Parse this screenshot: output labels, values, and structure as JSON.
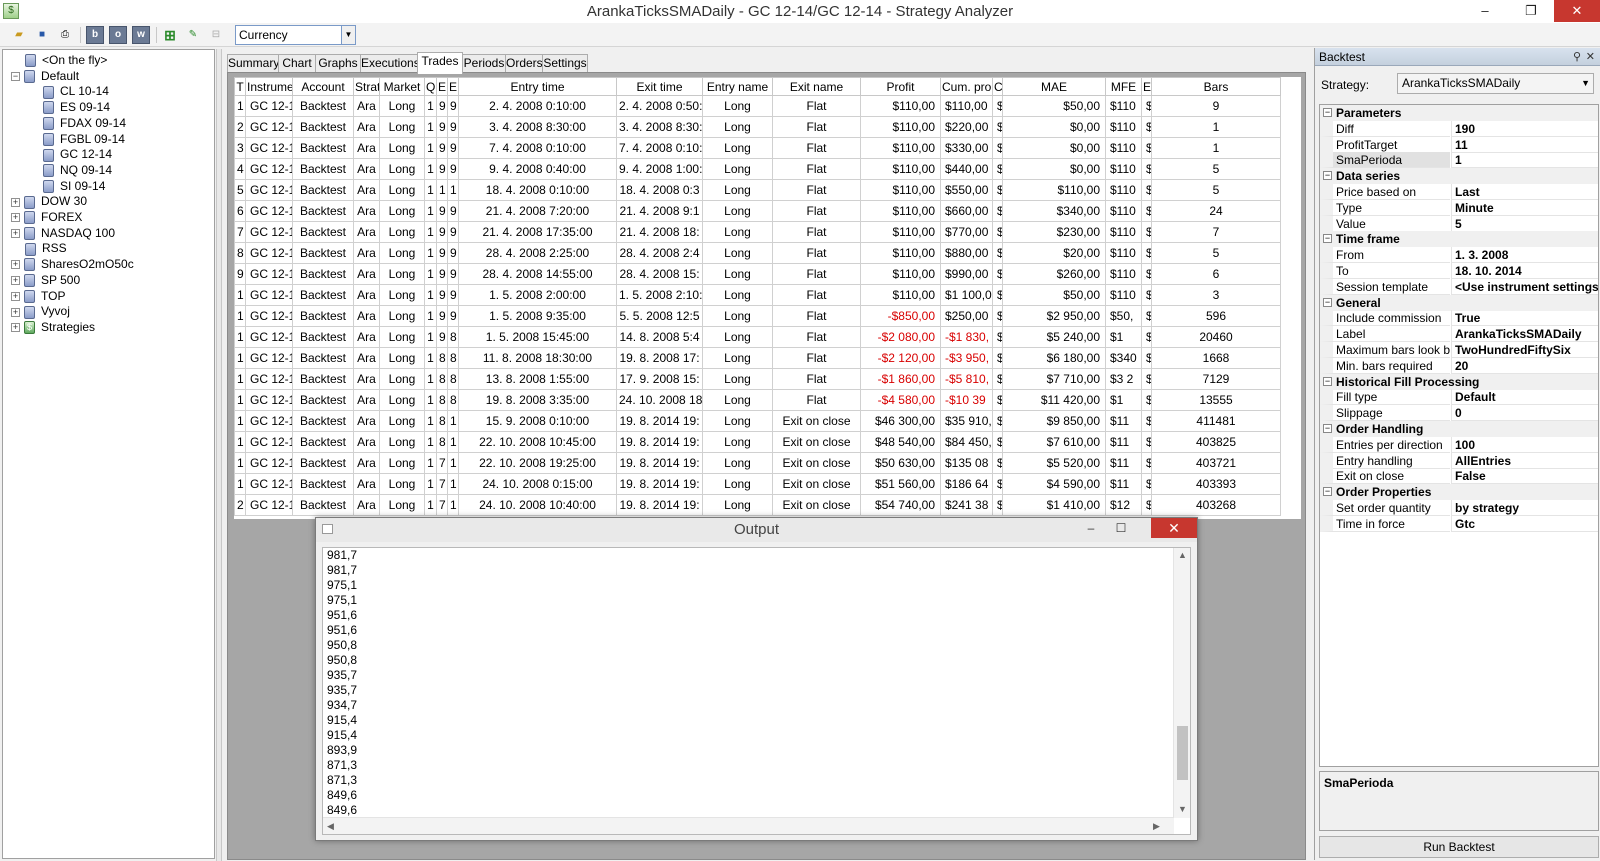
{
  "window": {
    "title": "ArankaTicksSMADaily - GC 12-14/GC 12-14 - Strategy Analyzer",
    "minimize": "–",
    "maximize": "❐",
    "close": "✕"
  },
  "toolbar": {
    "btn_b": "b",
    "btn_o": "o",
    "btn_w": "w",
    "currency": "Currency"
  },
  "tree": [
    {
      "label": "<On the fly>",
      "indent": 1,
      "expander": "",
      "icon": "db"
    },
    {
      "label": "Default",
      "indent": 0,
      "expander": "−",
      "icon": "db"
    },
    {
      "label": "CL 10-14",
      "indent": 2,
      "expander": "",
      "icon": "db"
    },
    {
      "label": "ES 09-14",
      "indent": 2,
      "expander": "",
      "icon": "db"
    },
    {
      "label": "FDAX 09-14",
      "indent": 2,
      "expander": "",
      "icon": "db"
    },
    {
      "label": "FGBL 09-14",
      "indent": 2,
      "expander": "",
      "icon": "db"
    },
    {
      "label": "GC 12-14",
      "indent": 2,
      "expander": "",
      "icon": "db"
    },
    {
      "label": "NQ 09-14",
      "indent": 2,
      "expander": "",
      "icon": "db"
    },
    {
      "label": "SI 09-14",
      "indent": 2,
      "expander": "",
      "icon": "db"
    },
    {
      "label": "DOW 30",
      "indent": 0,
      "expander": "+",
      "icon": "db"
    },
    {
      "label": "FOREX",
      "indent": 0,
      "expander": "+",
      "icon": "db"
    },
    {
      "label": "NASDAQ 100",
      "indent": 0,
      "expander": "+",
      "icon": "db"
    },
    {
      "label": "RSS",
      "indent": 1,
      "expander": "",
      "icon": "db"
    },
    {
      "label": "SharesO2mO50c",
      "indent": 0,
      "expander": "+",
      "icon": "db"
    },
    {
      "label": "SP 500",
      "indent": 0,
      "expander": "+",
      "icon": "db"
    },
    {
      "label": "TOP",
      "indent": 0,
      "expander": "+",
      "icon": "db"
    },
    {
      "label": "Vyvoj",
      "indent": 0,
      "expander": "+",
      "icon": "db"
    },
    {
      "label": "Strategies",
      "indent": 0,
      "expander": "+",
      "icon": "strategy"
    }
  ],
  "tabs": [
    "Summary",
    "Chart",
    "Graphs",
    "Executions",
    "Trades",
    "Periods",
    "Orders",
    "Settings"
  ],
  "active_tab": "Trades",
  "trades": {
    "columns": [
      "T",
      "Instrume",
      "Account",
      "Strat",
      "Market",
      "Q",
      "E",
      "E",
      "Entry time",
      "Exit time",
      "Entry name",
      "Exit name",
      "Profit",
      "Cum. pro",
      "C",
      "MAE",
      "MFE",
      "E",
      "Bars"
    ],
    "rows": [
      [
        "1",
        "GC 12-1",
        "Backtest",
        "Ara",
        "Long",
        "1",
        "9",
        "9",
        "2. 4. 2008 0:10:00",
        "2. 4. 2008 0:50:",
        "Long",
        "Flat",
        "$110,00",
        "$110,00",
        "$",
        "$50,00",
        "$110",
        "$",
        "9"
      ],
      [
        "2",
        "GC 12-1",
        "Backtest",
        "Ara",
        "Long",
        "1",
        "9",
        "9",
        "3. 4. 2008 8:30:00",
        "3. 4. 2008 8:30:",
        "Long",
        "Flat",
        "$110,00",
        "$220,00",
        "$",
        "$0,00",
        "$110",
        "$",
        "1"
      ],
      [
        "3",
        "GC 12-1",
        "Backtest",
        "Ara",
        "Long",
        "1",
        "9",
        "9",
        "7. 4. 2008 0:10:00",
        "7. 4. 2008 0:10:",
        "Long",
        "Flat",
        "$110,00",
        "$330,00",
        "$",
        "$0,00",
        "$110",
        "$",
        "1"
      ],
      [
        "4",
        "GC 12-1",
        "Backtest",
        "Ara",
        "Long",
        "1",
        "9",
        "9",
        "9. 4. 2008 0:40:00",
        "9. 4. 2008 1:00:",
        "Long",
        "Flat",
        "$110,00",
        "$440,00",
        "$",
        "$0,00",
        "$110",
        "$",
        "5"
      ],
      [
        "5",
        "GC 12-1",
        "Backtest",
        "Ara",
        "Long",
        "1",
        "1",
        "1",
        "18. 4. 2008 0:10:00",
        "18. 4. 2008 0:3",
        "Long",
        "Flat",
        "$110,00",
        "$550,00",
        "$",
        "$110,00",
        "$110",
        "$",
        "5"
      ],
      [
        "6",
        "GC 12-1",
        "Backtest",
        "Ara",
        "Long",
        "1",
        "9",
        "9",
        "21. 4. 2008 7:20:00",
        "21. 4. 2008 9:1",
        "Long",
        "Flat",
        "$110,00",
        "$660,00",
        "$",
        "$340,00",
        "$110",
        "$",
        "24"
      ],
      [
        "7",
        "GC 12-1",
        "Backtest",
        "Ara",
        "Long",
        "1",
        "9",
        "9",
        "21. 4. 2008 17:35:00",
        "21. 4. 2008 18:",
        "Long",
        "Flat",
        "$110,00",
        "$770,00",
        "$",
        "$230,00",
        "$110",
        "$",
        "7"
      ],
      [
        "8",
        "GC 12-1",
        "Backtest",
        "Ara",
        "Long",
        "1",
        "9",
        "9",
        "28. 4. 2008 2:25:00",
        "28. 4. 2008 2:4",
        "Long",
        "Flat",
        "$110,00",
        "$880,00",
        "$",
        "$20,00",
        "$110",
        "$",
        "5"
      ],
      [
        "9",
        "GC 12-1",
        "Backtest",
        "Ara",
        "Long",
        "1",
        "9",
        "9",
        "28. 4. 2008 14:55:00",
        "28. 4. 2008 15:",
        "Long",
        "Flat",
        "$110,00",
        "$990,00",
        "$",
        "$260,00",
        "$110",
        "$",
        "6"
      ],
      [
        "1",
        "GC 12-1",
        "Backtest",
        "Ara",
        "Long",
        "1",
        "9",
        "9",
        "1. 5. 2008 2:00:00",
        "1. 5. 2008 2:10:",
        "Long",
        "Flat",
        "$110,00",
        "$1 100,0",
        "$",
        "$50,00",
        "$110",
        "$",
        "3"
      ],
      [
        "1",
        "GC 12-1",
        "Backtest",
        "Ara",
        "Long",
        "1",
        "9",
        "9",
        "1. 5. 2008 9:35:00",
        "5. 5. 2008 12:5",
        "Long",
        "Flat",
        "-$850,00",
        "$250,00",
        "$",
        "$2 950,00",
        "$50,",
        "$",
        "596"
      ],
      [
        "1",
        "GC 12-1",
        "Backtest",
        "Ara",
        "Long",
        "1",
        "9",
        "8",
        "1. 5. 2008 15:45:00",
        "14. 8. 2008 5:4",
        "Long",
        "Flat",
        "-$2 080,00",
        "-$1 830,",
        "$",
        "$5 240,00",
        "$1",
        "$",
        "20460"
      ],
      [
        "1",
        "GC 12-1",
        "Backtest",
        "Ara",
        "Long",
        "1",
        "8",
        "8",
        "11. 8. 2008 18:30:00",
        "19. 8. 2008 17:",
        "Long",
        "Flat",
        "-$2 120,00",
        "-$3 950,",
        "$",
        "$6 180,00",
        "$340",
        "$",
        "1668"
      ],
      [
        "1",
        "GC 12-1",
        "Backtest",
        "Ara",
        "Long",
        "1",
        "8",
        "8",
        "13. 8. 2008 1:55:00",
        "17. 9. 2008 15:",
        "Long",
        "Flat",
        "-$1 860,00",
        "-$5 810,",
        "$",
        "$7 710,00",
        "$3 2",
        "$",
        "7129"
      ],
      [
        "1",
        "GC 12-1",
        "Backtest",
        "Ara",
        "Long",
        "1",
        "8",
        "8",
        "19. 8. 2008 3:35:00",
        "24. 10. 2008 18",
        "Long",
        "Flat",
        "-$4 580,00",
        "-$10 39",
        "$",
        "$11 420,00",
        "$1",
        "$",
        "13555"
      ],
      [
        "1",
        "GC 12-1",
        "Backtest",
        "Ara",
        "Long",
        "1",
        "8",
        "1",
        "15. 9. 2008 0:10:00",
        "19. 8. 2014 19:",
        "Long",
        "Exit on close",
        "$46 300,00",
        "$35 910,",
        "$",
        "$9 850,00",
        "$11",
        "$",
        "411481"
      ],
      [
        "1",
        "GC 12-1",
        "Backtest",
        "Ara",
        "Long",
        "1",
        "8",
        "1",
        "22. 10. 2008 10:45:00",
        "19. 8. 2014 19:",
        "Long",
        "Exit on close",
        "$48 540,00",
        "$84 450,",
        "$",
        "$7 610,00",
        "$11",
        "$",
        "403825"
      ],
      [
        "1",
        "GC 12-1",
        "Backtest",
        "Ara",
        "Long",
        "1",
        "7",
        "1",
        "22. 10. 2008 19:25:00",
        "19. 8. 2014 19:",
        "Long",
        "Exit on close",
        "$50 630,00",
        "$135 08",
        "$",
        "$5 520,00",
        "$11",
        "$",
        "403721"
      ],
      [
        "1",
        "GC 12-1",
        "Backtest",
        "Ara",
        "Long",
        "1",
        "7",
        "1",
        "24. 10. 2008 0:15:00",
        "19. 8. 2014 19:",
        "Long",
        "Exit on close",
        "$51 560,00",
        "$186 64",
        "$",
        "$4 590,00",
        "$11",
        "$",
        "403393"
      ],
      [
        "2",
        "GC 12-1",
        "Backtest",
        "Ara",
        "Long",
        "1",
        "7",
        "1",
        "24. 10. 2008 10:40:00",
        "19. 8. 2014 19:",
        "Long",
        "Exit on close",
        "$54 740,00",
        "$241 38",
        "$",
        "$1 410,00",
        "$12",
        "$",
        "403268"
      ]
    ]
  },
  "output": {
    "title": "Output",
    "minimize": "–",
    "maximize": "☐",
    "close": "✕",
    "lines": [
      "981,7",
      "981,7",
      "975,1",
      "975,1",
      "951,6",
      "951,6",
      "950,8",
      "950,8",
      "935,7",
      "935,7",
      "934,7",
      "915,4",
      "915,4",
      "893,9",
      "871,3",
      "871,3",
      "849,6",
      "849,6"
    ]
  },
  "backtest": {
    "panel_title": "Backtest",
    "strategy_label": "Strategy:",
    "strategy_value": "ArankaTicksSMADaily",
    "categories": [
      {
        "name": "Parameters",
        "props": [
          {
            "name": "Diff",
            "value": "190"
          },
          {
            "name": "ProfitTarget",
            "value": "11"
          },
          {
            "name": "SmaPerioda",
            "value": "1",
            "selected": true
          }
        ]
      },
      {
        "name": "Data series",
        "props": [
          {
            "name": "Price based on",
            "value": "Last"
          },
          {
            "name": "Type",
            "value": "Minute"
          },
          {
            "name": "Value",
            "value": "5"
          }
        ]
      },
      {
        "name": "Time frame",
        "props": [
          {
            "name": "From",
            "value": "1. 3. 2008"
          },
          {
            "name": "To",
            "value": "18. 10. 2014"
          },
          {
            "name": "Session template",
            "value": "<Use instrument settings>"
          }
        ]
      },
      {
        "name": "General",
        "props": [
          {
            "name": "Include commission",
            "value": "True"
          },
          {
            "name": "Label",
            "value": "ArankaTicksSMADaily"
          },
          {
            "name": "Maximum bars look bac",
            "value": "TwoHundredFiftySix"
          },
          {
            "name": "Min. bars required",
            "value": "20"
          }
        ]
      },
      {
        "name": "Historical Fill Processing",
        "props": [
          {
            "name": "Fill type",
            "value": "Default"
          },
          {
            "name": "Slippage",
            "value": "0"
          }
        ]
      },
      {
        "name": "Order Handling",
        "props": [
          {
            "name": "Entries per direction",
            "value": "100"
          },
          {
            "name": "Entry handling",
            "value": "AllEntries"
          },
          {
            "name": "Exit on close",
            "value": "False"
          }
        ]
      },
      {
        "name": "Order Properties",
        "props": [
          {
            "name": "Set order quantity",
            "value": "by strategy"
          },
          {
            "name": "Time in force",
            "value": "Gtc"
          }
        ]
      }
    ],
    "description_title": "SmaPerioda",
    "run_button": "Run Backtest"
  }
}
